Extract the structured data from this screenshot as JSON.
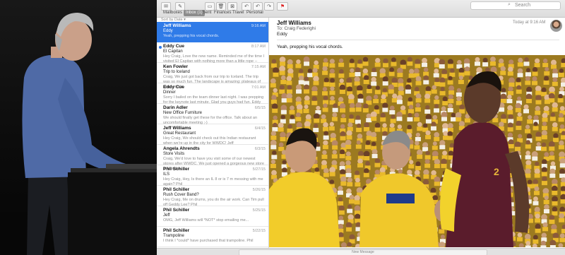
{
  "toolbar": {
    "search_placeholder": "Search"
  },
  "favorites": [
    {
      "label": "Mailboxes"
    },
    {
      "label": "Inbox (1)"
    },
    {
      "label": "Sent"
    },
    {
      "label": "Finances"
    },
    {
      "label": "Travel"
    },
    {
      "label": "Personal"
    }
  ],
  "list": {
    "sort_label": "Sort by Date ▾",
    "messages": [
      {
        "from": "Jeff Williams",
        "date": "9:16 AM",
        "subject": "Eddy",
        "preview": "Yeah, prepping his vocal chords.",
        "selected": true
      },
      {
        "from": "Eddy Cue",
        "date": "8:17 AM",
        "subject": "El Capitan",
        "preview": "Hey Craig, Love the new name. Reminded me of the time I visited El Capitan with nothing more than a little rope -- ",
        "unread": true
      },
      {
        "from": "Ken Fowler",
        "date": "7:15 AM",
        "subject": "Trip to Iceland",
        "preview": "Craig, We just got back from our trip to Iceland. The trip was so much fun. The landscape is amazing: plateaus of sand and la"
      },
      {
        "from": "Eddy Cue",
        "date": "7:01 AM",
        "subject": "Dinner",
        "preview": "Sorry I bailed on the team dinner last night. I was prepping for the keynote last minute. Glad you guys had fun. Eddy"
      },
      {
        "from": "Darin Adler",
        "date": "6/5/15",
        "subject": "New Office Furniture",
        "preview": "We should finally get these for the office. Talk about an uncomfortable meeting ;-)"
      },
      {
        "from": "Jeff Williams",
        "date": "6/4/15",
        "subject": "Great Restaurant",
        "preview": "Hey Craig, We should check out this Indian restaurant when we're up in the city for WWDC! Jeff"
      },
      {
        "from": "Angela Ahrendts",
        "date": "6/3/15",
        "subject": "Store Visits",
        "preview": "Craig, We'd love to have you visit some of our newest stores after WWDC. We just opened a gorgeous new store in Istanbu"
      },
      {
        "from": "Phil Schiller",
        "date": "5/27/15",
        "subject": "ILS",
        "preview": "Hey Craig, Hey, Is there an IL 8 or is 7 m messing with me again? Phil"
      },
      {
        "from": "Phil Schiller",
        "date": "5/26/15",
        "subject": "Rush Cover Band?",
        "preview": "Hey Craig, Me on drums, you do the air work. Can Tim pull off Geddy Lee? Phil"
      },
      {
        "from": "Phil Schiller",
        "date": "5/25/15",
        "subject": "Jeff",
        "preview": "OMG, Jeff Williams will *NOT* stop emailing me..."
      },
      {
        "from": "Phil Schiller",
        "date": "5/22/15",
        "subject": "Trampoline",
        "preview": "I think I *could* have purchased that trampoline. Phil"
      }
    ]
  },
  "reader": {
    "from": "Jeff Williams",
    "date": "Today at 9:16 AM",
    "to_label": "To:",
    "to": "Craig Federighi",
    "subject": "Eddy",
    "body": "Yeah, prepping his vocal chords."
  },
  "bottom": {
    "new_message_label": "New Message"
  },
  "colors": {
    "selection_blue": "#2f7be8",
    "crowd_yellow": "#e9b92c",
    "jersey_wine": "#5a1c2c"
  }
}
